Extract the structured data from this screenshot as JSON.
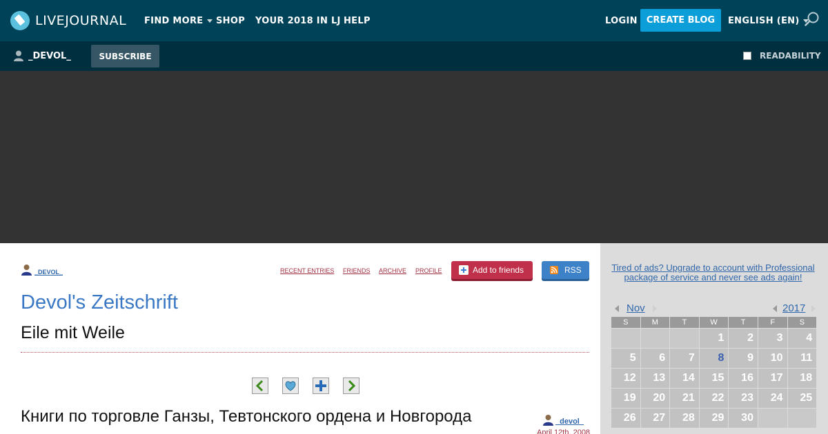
{
  "header": {
    "logo_text": "LIVEJOURNAL",
    "nav": [
      "FIND MORE",
      "SHOP",
      "YOUR 2018 IN LJ",
      "HELP"
    ],
    "login": "LOGIN",
    "create_blog": "CREATE BLOG",
    "language": "ENGLISH (EN)"
  },
  "subbar": {
    "username": "_DEVOL_",
    "subscribe": "SUBSCRIBE",
    "readability": "READABILITY"
  },
  "journal": {
    "user": "_devol_",
    "links": [
      "RECENT ENTRIES",
      "FRIENDS",
      "ARCHIVE",
      "PROFILE"
    ],
    "add_to_friends": "Add to friends",
    "rss": "RSS",
    "title": "Devol's Zeitschrift",
    "subtitle": "Eile mit Weile"
  },
  "entry": {
    "title": "Книги по торговле Ганзы, Тевтонского ордена и Новгорода",
    "user": "_devol_",
    "date": "April 12th, 2008"
  },
  "sidebar": {
    "ad_note": "Tired of ads? Upgrade to account with Professional package of service and never see ads again!",
    "calendar": {
      "month": "Nov",
      "year": "2017",
      "weekdays": [
        "S",
        "M",
        "T",
        "W",
        "T",
        "F",
        "S"
      ],
      "weeks": [
        [
          "",
          "",
          "",
          "1",
          "2",
          "3",
          "4"
        ],
        [
          "5",
          "6",
          "7",
          "8",
          "9",
          "10",
          "11"
        ],
        [
          "12",
          "13",
          "14",
          "15",
          "16",
          "17",
          "18"
        ],
        [
          "19",
          "20",
          "21",
          "22",
          "23",
          "24",
          "25"
        ],
        [
          "26",
          "27",
          "28",
          "29",
          "30",
          "",
          ""
        ]
      ],
      "linked_day": "8"
    }
  },
  "colors": {
    "topbar": "#004359",
    "subbar": "#002f3f",
    "create_blog": "#0c9ed9",
    "journal_title": "#3a78c5",
    "add_to_friends": "#c0304a",
    "rss": "#3d82c9"
  }
}
